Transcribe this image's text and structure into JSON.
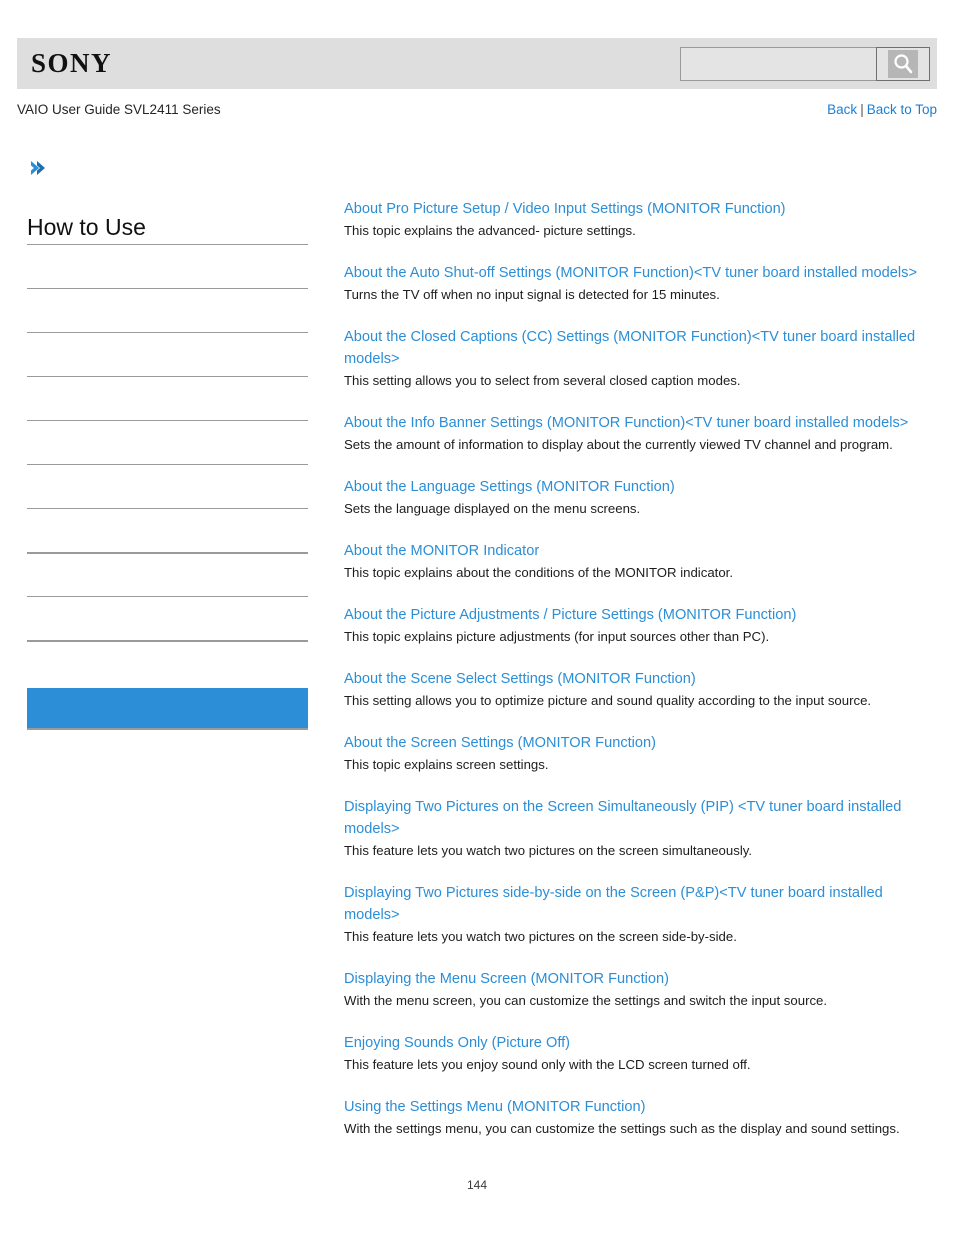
{
  "header": {
    "logo_text": "SONY",
    "search": {
      "value": "",
      "placeholder": "",
      "icon": "search-icon",
      "button_label": ""
    }
  },
  "subheader": {
    "guide_title": "VAIO User Guide SVL2411 Series",
    "links": {
      "back": "Back",
      "separator": "|",
      "back_to_top": "Back to Top"
    }
  },
  "sidebar": {
    "breadcrumb_icon": "chevron-right-icon",
    "heading": "How to Use",
    "items": [
      {
        "label": ""
      },
      {
        "label": ""
      },
      {
        "label": ""
      },
      {
        "label": ""
      },
      {
        "label": ""
      },
      {
        "label": ""
      },
      {
        "label": ""
      },
      {
        "label": ""
      },
      {
        "label": ""
      },
      {
        "label": ""
      },
      {
        "label": "",
        "active": true
      }
    ]
  },
  "main": {
    "topics": [
      {
        "title": "About Pro Picture Setup / Video Input Settings (MONITOR Function)",
        "description": "This topic explains the advanced- picture settings."
      },
      {
        "title": "About the Auto Shut-off Settings (MONITOR Function)<TV tuner board installed models>",
        "description": "Turns the TV off when no input signal is detected for 15 minutes."
      },
      {
        "title": "About the Closed Captions (CC) Settings (MONITOR Function)<TV tuner board installed models>",
        "description": "This setting allows you to select from several closed caption modes."
      },
      {
        "title": "About the Info Banner Settings (MONITOR Function)<TV tuner board installed models>",
        "description": "Sets the amount of information to display about the currently viewed TV channel and program."
      },
      {
        "title": "About the Language Settings (MONITOR Function)",
        "description": "Sets the language displayed on the menu screens."
      },
      {
        "title": "About the MONITOR Indicator",
        "description": "This topic explains about the conditions of the MONITOR indicator."
      },
      {
        "title": "About the Picture Adjustments / Picture Settings (MONITOR Function)",
        "description": "This topic explains picture adjustments (for input sources other than PC)."
      },
      {
        "title": "About the Scene Select Settings (MONITOR Function)",
        "description": "This setting allows you to optimize picture and sound quality according to the input source."
      },
      {
        "title": "About the Screen Settings (MONITOR Function)",
        "description": "This topic explains screen settings."
      },
      {
        "title": "Displaying Two Pictures on the Screen Simultaneously (PIP) <TV tuner board installed models>",
        "description": "This feature lets you watch two pictures on the screen simultaneously."
      },
      {
        "title": "Displaying Two Pictures side-by-side on the Screen (P&P)<TV tuner board installed models>",
        "description": "This feature lets you watch two pictures on the screen side-by-side."
      },
      {
        "title": "Displaying the Menu Screen (MONITOR Function)",
        "description": "With the menu screen, you can customize the settings and switch the input source."
      },
      {
        "title": "Enjoying Sounds Only (Picture Off)",
        "description": "This feature lets you enjoy sound only with the LCD screen turned off."
      },
      {
        "title": "Using the Settings Menu (MONITOR Function)",
        "description": "With the settings menu, you can customize the settings such as the display and sound settings."
      }
    ]
  },
  "footer": {
    "page_number": "144"
  },
  "colors": {
    "link_blue": "#2b8ed6",
    "nav_link_blue": "#1a7fd4",
    "header_gray": "#dedede",
    "active_blue": "#2b8ed6",
    "rule_gray": "#9a9a9a"
  }
}
